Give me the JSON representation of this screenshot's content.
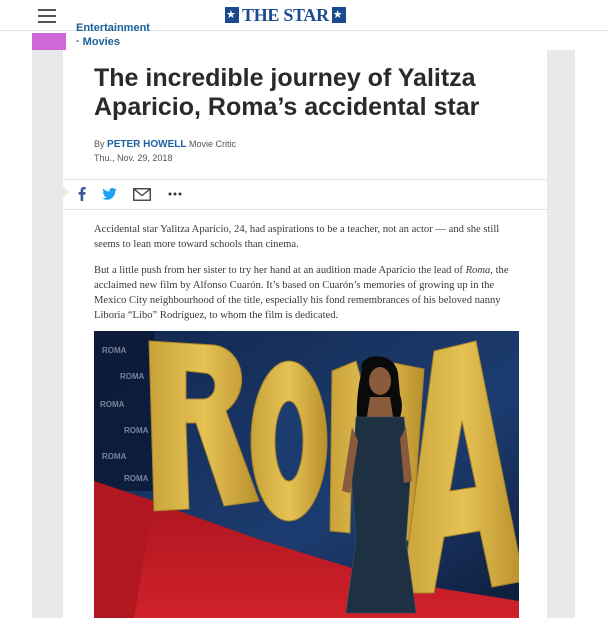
{
  "header": {
    "logo_text": "THE STAR",
    "menu_icon": "hamburger-menu-icon"
  },
  "breadcrumb": {
    "section": "Entertainment",
    "subsection": "Movies",
    "separator": "·",
    "accent_color": "#cf67d8"
  },
  "article": {
    "headline": "The incredible journey of Yalitza Aparicio, Roma’s accidental star",
    "by_prefix": "By",
    "author": "PETER HOWELL",
    "author_role": "Movie Critic",
    "date": "Thu., Nov. 29, 2018",
    "share_icons": [
      "facebook-icon",
      "twitter-icon",
      "email-icon",
      "more-icon"
    ],
    "paragraph1": "Accidental star Yalitza Aparicio, 24, had aspirations to be a teacher, not an actor — and she still seems to lean more toward schools than cinema.",
    "paragraph2_before": "But a little push from her sister to try her hand at an audition made Aparicio the lead of ",
    "paragraph2_italic": "Roma",
    "paragraph2_after": ", the acclaimed new film by Alfonso Cuarón. It’s based on Cuarón’s memories of growing up in the Mexico City neighbourhood of the title, especially his fond remembrances of his beloved nanny Liboria “Libo” Rodríguez, to whom the film is dedicated.",
    "photo_sign_text": "ROMA"
  },
  "colors": {
    "brand": "#1b4b8f",
    "link": "#1a5f9e",
    "carpet": "#c21a24"
  }
}
